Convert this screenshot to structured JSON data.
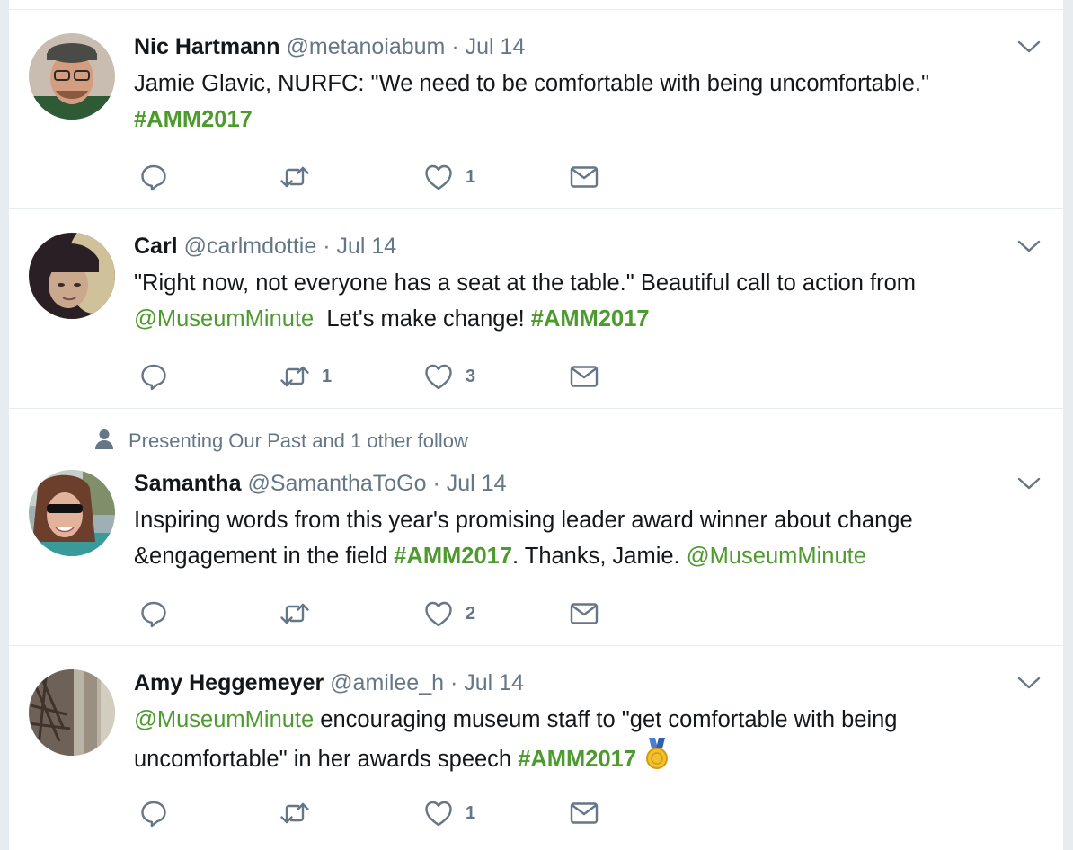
{
  "tweets": [
    {
      "name": "Nic Hartmann",
      "handle": "@metanoiabum",
      "dot": "·",
      "date": "Jul 14",
      "text": {
        "part1": "Jamie Glavic, NURFC: \"We need to be comfortable with being uncomfortable.\"",
        "hashtag": "#AMM2017"
      },
      "counts": {
        "reply": "",
        "retweet": "",
        "like": "1"
      }
    },
    {
      "name": "Carl",
      "handle": "@carlmdottie",
      "dot": "·",
      "date": "Jul 14",
      "text": {
        "part1": "\"Right now, not everyone has a seat at the table.\" Beautiful call to action from",
        "mention": "@MuseumMinute",
        "part2": "  Let's make change! ",
        "hashtag": "#AMM2017"
      },
      "counts": {
        "reply": "",
        "retweet": "1",
        "like": "3"
      }
    },
    {
      "context": "Presenting Our Past and 1 other follow",
      "name": "Samantha",
      "handle": "@SamanthaToGo",
      "dot": "·",
      "date": "Jul 14",
      "text": {
        "part1": "Inspiring words from this year's promising leader award winner about change",
        "part2": "&engagement in the field ",
        "hashtag": "#AMM2017",
        "part3": ". Thanks, Jamie. ",
        "mention": "@MuseumMinute"
      },
      "counts": {
        "reply": "",
        "retweet": "",
        "like": "2"
      }
    },
    {
      "name": "Amy Heggemeyer",
      "handle": "@amilee_h",
      "dot": "·",
      "date": "Jul 14",
      "text": {
        "mention": "@MuseumMinute",
        "part1": " encouraging museum staff to \"get comfortable with being",
        "part2": "uncomfortable\" in her awards speech ",
        "hashtag": "#AMM2017"
      },
      "counts": {
        "reply": "",
        "retweet": "",
        "like": "1"
      }
    }
  ],
  "icons": {
    "reply": "reply-icon",
    "retweet": "retweet-icon",
    "like": "heart-icon",
    "dm": "envelope-icon",
    "caret": "chevron-down-icon",
    "context": "person-icon",
    "emoji": "medal-icon"
  },
  "colors": {
    "link": "#4d9b2e",
    "muted": "#657786",
    "text": "#14171a",
    "border": "#e6ecf0"
  }
}
